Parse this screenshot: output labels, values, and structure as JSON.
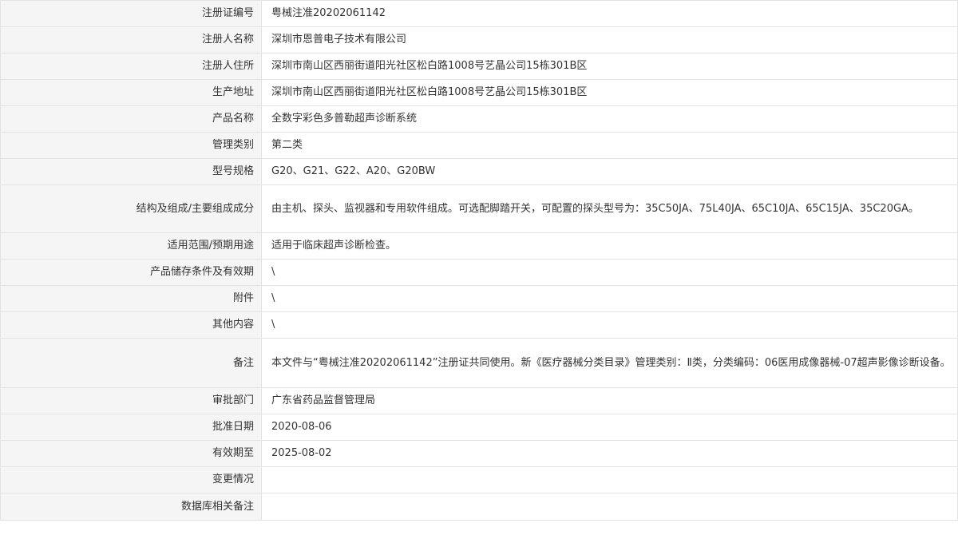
{
  "rows": [
    {
      "label": "注册证编号",
      "value": "粤械注准20202061142"
    },
    {
      "label": "注册人名称",
      "value": "深圳市恩普电子技术有限公司"
    },
    {
      "label": "注册人住所",
      "value": "深圳市南山区西丽街道阳光社区松白路1008号艺晶公司15栋301B区"
    },
    {
      "label": "生产地址",
      "value": "深圳市南山区西丽街道阳光社区松白路1008号艺晶公司15栋301B区"
    },
    {
      "label": "产品名称",
      "value": "全数字彩色多普勒超声诊断系统"
    },
    {
      "label": "管理类别",
      "value": "第二类"
    },
    {
      "label": "型号规格",
      "value": "G20、G21、G22、A20、G20BW"
    },
    {
      "label": "结构及组成/主要组成成分",
      "value": "由主机、探头、监视器和专用软件组成。可选配脚踏开关，可配置的探头型号为：35C50JA、75L40JA、65C10JA、65C15JA、35C20GA。"
    },
    {
      "label": "适用范围/预期用途",
      "value": "适用于临床超声诊断检查。"
    },
    {
      "label": "产品储存条件及有效期",
      "value": "\\"
    },
    {
      "label": "附件",
      "value": "\\"
    },
    {
      "label": "其他内容",
      "value": "\\"
    },
    {
      "label": "备注",
      "value": "本文件与“粤械注准20202061142”注册证共同使用。新《医疗器械分类目录》管理类别：Ⅱ类，分类编码：06医用成像器械-07超声影像诊断设备。"
    },
    {
      "label": "审批部门",
      "value": "广东省药品监督管理局"
    },
    {
      "label": "批准日期",
      "value": "2020-08-06"
    },
    {
      "label": "有效期至",
      "value": "2025-08-02"
    },
    {
      "label": "变更情况",
      "value": ""
    },
    {
      "label": "数据库相关备注",
      "value": ""
    }
  ]
}
